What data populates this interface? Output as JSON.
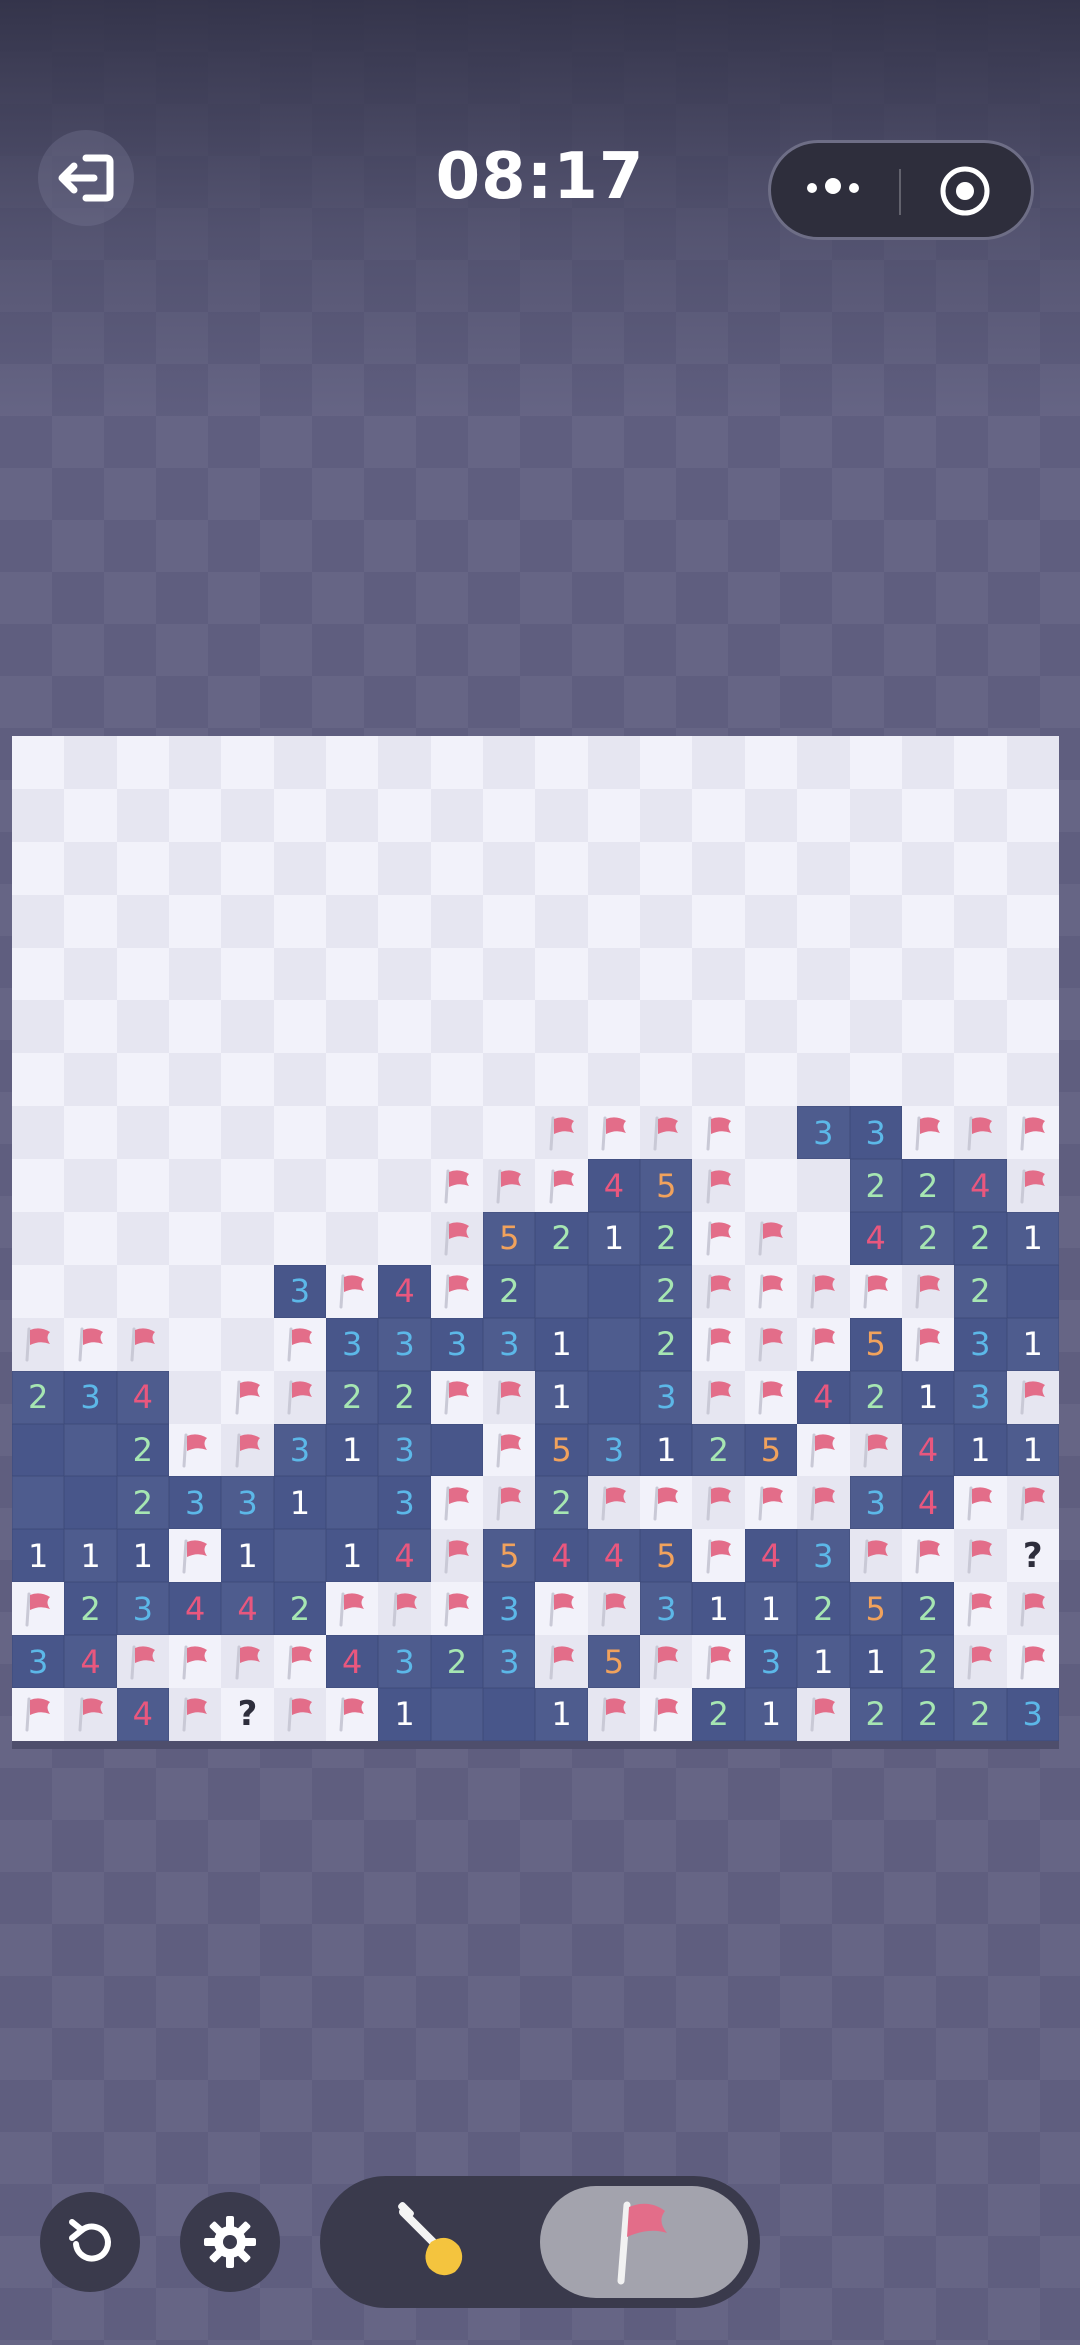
{
  "header": {
    "timer": "08:17",
    "exit_icon": "exit-icon",
    "menu_icon": "more-dots-icon",
    "close_icon": "target-icon"
  },
  "colors": {
    "hidden_light": "#f2f2fa",
    "hidden_dark": "#e6e6f1",
    "open": "#4e5c8e",
    "flag": "#e36d89",
    "n1": "#ffffff",
    "n2": "#a6e6b2",
    "n3": "#5cb8e8",
    "n4": "#e9577e",
    "n5": "#f1a25c",
    "n6": "#f3e06a"
  },
  "board": {
    "cols": 20,
    "rows_count": 19,
    "legend": ". hidden, F flag, ? question, 0 empty open, digits open number",
    "rows": [
      "....................",
      "....................",
      "....................",
      "....................",
      "....................",
      "....................",
      "....................",
      "..........FFFF.33FFF",
      "........FFF45F..224F",
      "........F5212FF.4221",
      ".....3F4F2002FFFFF20",
      "FFF..F3333102FFF5F31",
      "234.FF22FF103FF4213F",
      "002FF3130F53125FF411",
      "00233103FF2FFFFF34FF",
      "111F1014F5445F43FFF?",
      "F23442FFF3FF311252FF",
      "34FFFF4323F5FF3112FF",
      "FF4F?FF1001FF21F2223"
    ]
  },
  "bottom": {
    "undo_icon": "undo-icon",
    "settings_icon": "gear-icon",
    "dig_icon": "shovel-icon",
    "flag_icon": "flag-icon",
    "active_mode": "flag"
  }
}
